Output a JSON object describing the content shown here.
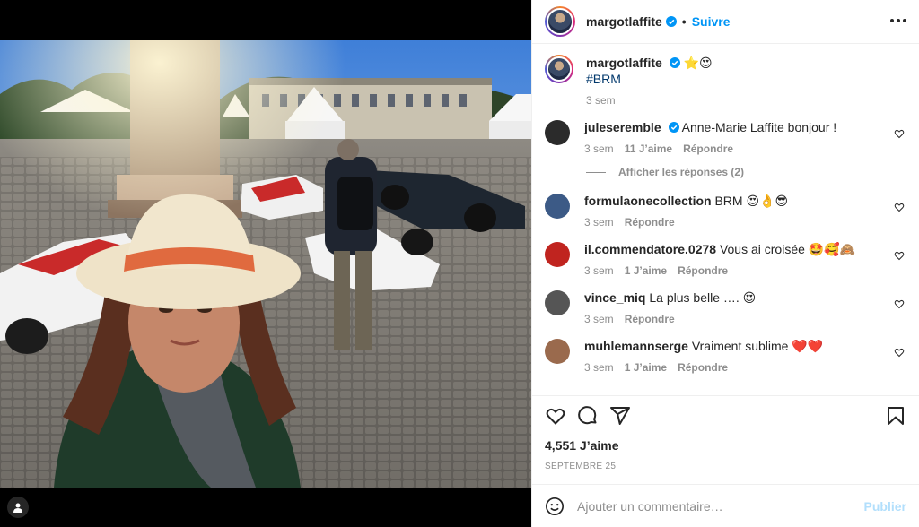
{
  "post": {
    "author": "margotlaffite",
    "follow_label": "Suivre",
    "caption_emojis": "⭐😍",
    "caption_hashtag": "#BRM",
    "caption_time": "3 sem"
  },
  "comments": [
    {
      "user": "juleseremble",
      "text": "Anne-Marie Laffite bonjour !",
      "time": "3 sem",
      "likes": "11 J’aime",
      "reply": "Répondre",
      "verified": true,
      "avatar_color": "#2b2b2b"
    },
    {
      "user": "formulaonecollection",
      "text": "BRM 😍👌😎",
      "time": "3 sem",
      "likes": "",
      "reply": "Répondre",
      "verified": false,
      "avatar_color": "#3c5a86"
    },
    {
      "user": "il.commendatore.0278",
      "text": "Vous ai croisée 🤩🥰🙈",
      "time": "3 sem",
      "likes": "1 J’aime",
      "reply": "Répondre",
      "verified": false,
      "avatar_color": "#c0241f"
    },
    {
      "user": "vince_miq",
      "text": "La plus belle …. 😍",
      "time": "3 sem",
      "likes": "",
      "reply": "Répondre",
      "verified": false,
      "avatar_color": "#555555"
    },
    {
      "user": "muhlemannserge",
      "text": "Vraiment sublime ❤️❤️",
      "time": "3 sem",
      "likes": "1 J’aime",
      "reply": "Répondre",
      "verified": false,
      "avatar_color": "#9a6a4d"
    }
  ],
  "view_replies": "Afficher les réponses (2)",
  "likes_count": "4,551 J’aime",
  "date": "SEPTEMBRE 25",
  "add_comment": {
    "placeholder": "Ajouter un commentaire…",
    "publish": "Publier"
  },
  "colors": {
    "accent": "#0095f6",
    "text": "#262626",
    "muted": "#8e8e8e",
    "link": "#00376b"
  },
  "icons": [
    "verified-badge-icon",
    "more-options-icon",
    "heart-icon",
    "comment-icon",
    "share-icon",
    "save-icon",
    "emoji-icon",
    "user-tag-icon"
  ]
}
